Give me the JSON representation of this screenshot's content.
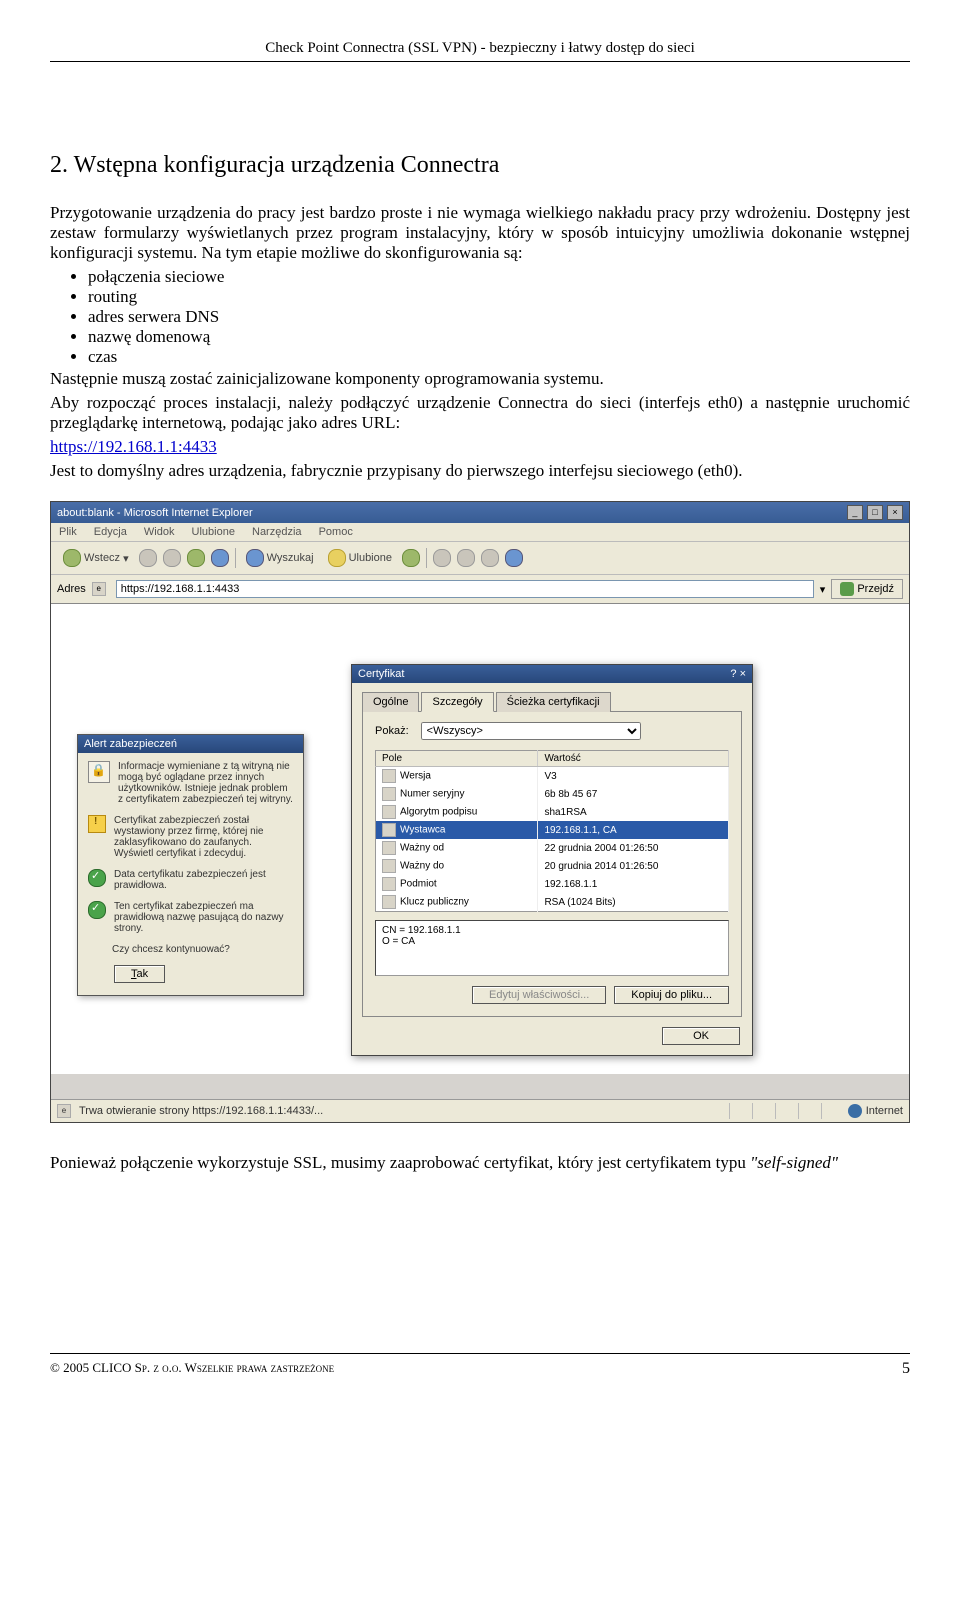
{
  "doc": {
    "header": "Check Point Connectra (SSL VPN) - bezpieczny i łatwy dostęp do sieci",
    "heading": "2. Wstępna konfiguracja urządzenia Connectra",
    "para1": "Przygotowanie urządzenia do pracy jest bardzo proste i nie wymaga wielkiego nakładu pracy przy wdrożeniu. Dostępny jest zestaw formularzy wyświetlanych przez program instalacyjny, który w sposób intuicyjny umożliwia dokonanie wstępnej konfiguracji systemu. Na tym etapie możliwe do skonfigurowania są:",
    "bullets": [
      "połączenia sieciowe",
      "routing",
      "adres serwera DNS",
      "nazwę domenową",
      "czas"
    ],
    "para2a": "Następnie muszą zostać zainicjalizowane komponenty oprogramowania systemu.",
    "para2b": "Aby rozpocząć proces instalacji, należy podłączyć urządzenie Connectra do sieci (interfejs eth0) a następnie uruchomić przeglądarkę internetową, podając jako adres URL:",
    "url": "https://192.168.1.1:4433",
    "para3": "Jest to domyślny adres urządzenia, fabrycznie przypisany do pierwszego interfejsu sieciowego (eth0).",
    "para4a": "Ponieważ połączenie wykorzystuje SSL, musimy zaaprobować certyfikat, który jest certyfikatem typu ",
    "para4b": "\"self-signed\"",
    "footer_left": "© 2005 CLICO Sp. z o.o. Wszelkie prawa zastrzeżone",
    "footer_page": "5"
  },
  "ie": {
    "title": "about:blank - Microsoft Internet Explorer",
    "menu": [
      "Plik",
      "Edycja",
      "Widok",
      "Ulubione",
      "Narzędzia",
      "Pomoc"
    ],
    "back": "Wstecz",
    "search": "Wyszukaj",
    "fav": "Ulubione",
    "addr_label": "Adres",
    "addr_value": "https://192.168.1.1:4433",
    "go": "Przejdź",
    "status_left": "Trwa otwieranie strony https://192.168.1.1:4433/...",
    "status_right": "Internet"
  },
  "alert": {
    "title": "Alert zabezpieczeń",
    "line1": "Informacje wymieniane z tą witryną nie mogą być oglądane przez innych użytkowników. Istnieje jednak problem z certyfikatem zabezpieczeń tej witryny.",
    "warn": "Certyfikat zabezpieczeń został wystawiony przez firmę, której nie zaklasyfikowano do zaufanych. Wyświetl certyfikat i zdecyduj.",
    "ok1": "Data certyfikatu zabezpieczeń jest prawidłowa.",
    "ok2": "Ten certyfikat zabezpieczeń ma prawidłową nazwę pasującą do nazwy strony.",
    "q": "Czy chcesz kontynuować?",
    "btn_tak": "Tak"
  },
  "cert": {
    "title": "Certyfikat",
    "help": "? ×",
    "tabs": [
      "Ogólne",
      "Szczegóły",
      "Ścieżka certyfikacji"
    ],
    "show_label": "Pokaż:",
    "show_value": "<Wszyscy>",
    "col_field": "Pole",
    "col_value": "Wartość",
    "rows": [
      {
        "f": "Wersja",
        "v": "V3"
      },
      {
        "f": "Numer seryjny",
        "v": "6b 8b 45 67"
      },
      {
        "f": "Algorytm podpisu",
        "v": "sha1RSA"
      },
      {
        "f": "Wystawca",
        "v": "192.168.1.1, CA"
      },
      {
        "f": "Ważny od",
        "v": "22 grudnia 2004 01:26:50"
      },
      {
        "f": "Ważny do",
        "v": "20 grudnia 2014 01:26:50"
      },
      {
        "f": "Podmiot",
        "v": "192.168.1.1"
      },
      {
        "f": "Klucz publiczny",
        "v": "RSA (1024 Bits)"
      }
    ],
    "detail": "CN = 192.168.1.1\nO = CA",
    "btn_edit": "Edytuj właściwości...",
    "btn_copy": "Kopiuj do pliku...",
    "btn_ok": "OK"
  }
}
